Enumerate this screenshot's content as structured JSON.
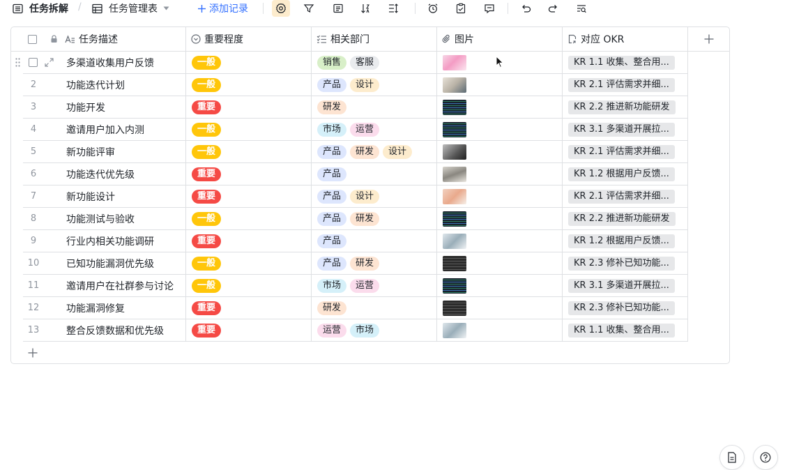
{
  "toolbar": {
    "doc_title": "任务拆解",
    "view_name": "任务管理表",
    "add_record": "添加记录"
  },
  "colors": {
    "important": "#f54a45",
    "normal": "#ffc60a",
    "accent": "#3370ff"
  },
  "headers": {
    "task": "任务描述",
    "priority": "重要程度",
    "dept": "相关部门",
    "image": "图片",
    "okr": "对应 OKR"
  },
  "rows": [
    {
      "num": "",
      "task": "多渠道收集用户反馈",
      "priority": "一般",
      "level": "normal",
      "depts": [
        "销售",
        "客服"
      ],
      "thumb": "pink",
      "okr": "KR 1.1 收集、整合用..."
    },
    {
      "num": "2",
      "task": "功能迭代计划",
      "priority": "一般",
      "level": "normal",
      "depts": [
        "产品",
        "设计"
      ],
      "thumb": "desk",
      "okr": "KR 2.1 评估需求并细..."
    },
    {
      "num": "3",
      "task": "功能开发",
      "priority": "重要",
      "level": "important",
      "depts": [
        "研发"
      ],
      "thumb": "code",
      "okr": "KR 2.2 推进新功能研发"
    },
    {
      "num": "4",
      "task": "邀请用户加入内测",
      "priority": "一般",
      "level": "normal",
      "depts": [
        "市场",
        "运营"
      ],
      "thumb": "code",
      "okr": "KR 3.1 多渠道开展拉..."
    },
    {
      "num": "5",
      "task": "新功能评审",
      "priority": "一般",
      "level": "normal",
      "depts": [
        "产品",
        "研发",
        "设计"
      ],
      "thumb": "small",
      "okr": "KR 2.1 评估需求并细..."
    },
    {
      "num": "6",
      "task": "功能迭代优先级",
      "priority": "重要",
      "level": "important",
      "depts": [
        "产品"
      ],
      "thumb": "wide",
      "okr": "KR 1.2 根据用户反馈..."
    },
    {
      "num": "7",
      "task": "新功能设计",
      "priority": "重要",
      "level": "important",
      "depts": [
        "产品",
        "设计"
      ],
      "thumb": "sketch",
      "okr": "KR 2.1 评估需求并细..."
    },
    {
      "num": "8",
      "task": "功能测试与验收",
      "priority": "一般",
      "level": "normal",
      "depts": [
        "产品",
        "研发"
      ],
      "thumb": "code",
      "okr": "KR 2.2 推进新功能研发"
    },
    {
      "num": "9",
      "task": "行业内相关功能调研",
      "priority": "重要",
      "level": "important",
      "depts": [
        "产品"
      ],
      "thumb": "office",
      "okr": "KR 1.2 根据用户反馈..."
    },
    {
      "num": "10",
      "task": "已知功能漏洞优先级",
      "priority": "一般",
      "level": "normal",
      "depts": [
        "产品",
        "研发"
      ],
      "thumb": "dark",
      "okr": "KR 2.3 修补已知功能..."
    },
    {
      "num": "11",
      "task": "邀请用户在社群参与讨论",
      "priority": "一般",
      "level": "normal",
      "depts": [
        "市场",
        "运营"
      ],
      "thumb": "code",
      "okr": "KR 3.1 多渠道开展拉..."
    },
    {
      "num": "12",
      "task": "功能漏洞修复",
      "priority": "重要",
      "level": "important",
      "depts": [
        "研发"
      ],
      "thumb": "dark",
      "okr": "KR 2.3 修补已知功能..."
    },
    {
      "num": "13",
      "task": "整合反馈数据和优先级",
      "priority": "重要",
      "level": "important",
      "depts": [
        "运营",
        "市场"
      ],
      "thumb": "office",
      "okr": "KR 1.1 收集、整合用..."
    }
  ],
  "tag_colors": {
    "销售": "#d8efc8",
    "客服": "#e9ebee",
    "产品": "#dde6fd",
    "设计": "#fdeccd",
    "研发": "#fde4d2",
    "市场": "#d5f0f9",
    "运营": "#fbdcec"
  },
  "icons": {
    "grid": "grid-icon",
    "settings": "gear-icon",
    "filter": "filter-icon",
    "group": "group-icon",
    "sort": "sort-icon",
    "rowheight": "row-height-icon",
    "alarm": "alarm-icon",
    "form": "form-icon",
    "comment": "comment-icon",
    "undo": "undo-icon",
    "redo": "redo-icon",
    "search": "search-icon",
    "doc": "document-icon",
    "help": "help-icon"
  }
}
